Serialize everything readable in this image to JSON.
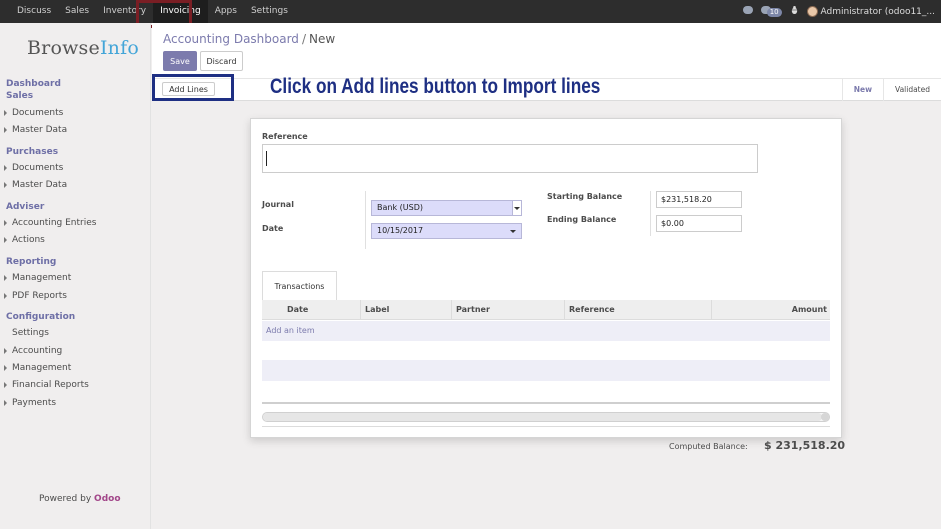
{
  "topbar": {
    "nav": [
      "Discuss",
      "Sales",
      "Inventory",
      "Invoicing",
      "Apps",
      "Settings"
    ],
    "active": "Invoicing",
    "chat_count": "",
    "activity_count": "10",
    "user": "Administrator (odoo11_..."
  },
  "sidebar": {
    "logo_main": "Browse",
    "logo_accent": "Info",
    "dashboard": "Dashboard",
    "sales": {
      "title": "Sales",
      "items": [
        "Documents",
        "Master Data"
      ]
    },
    "purchases": {
      "title": "Purchases",
      "items": [
        "Documents",
        "Master Data"
      ]
    },
    "adviser": {
      "title": "Adviser",
      "items": [
        "Accounting Entries",
        "Actions"
      ]
    },
    "reporting": {
      "title": "Reporting",
      "items": [
        "Management",
        "PDF Reports"
      ]
    },
    "configuration": {
      "title": "Configuration",
      "items": [
        "Settings",
        "Accounting",
        "Management",
        "Financial Reports",
        "Payments"
      ]
    },
    "powered_by": "Powered by",
    "odoo": "Odoo"
  },
  "control": {
    "breadcrumb_parent": "Accounting Dashboard",
    "breadcrumb_sep": "/",
    "breadcrumb_current": "New",
    "save": "Save",
    "discard": "Discard",
    "add_lines": "Add Lines",
    "annotation": "Click on Add lines button to Import lines",
    "status": [
      "New",
      "Validated"
    ],
    "status_current": "New"
  },
  "form": {
    "reference_label": "Reference",
    "reference_value": "",
    "journal_label": "Journal",
    "journal_value": "Bank (USD)",
    "date_label": "Date",
    "date_value": "10/15/2017",
    "starting_balance_label": "Starting Balance",
    "starting_balance_value": "$231,518.20",
    "ending_balance_label": "Ending Balance",
    "ending_balance_value": "$0.00",
    "tab": "Transactions",
    "columns": [
      "Date",
      "Label",
      "Partner",
      "Reference",
      "Amount"
    ],
    "add_item": "Add an item",
    "computed_label": "Computed Balance:",
    "computed_value": "$ 231,518.20"
  },
  "colors": {
    "accent": "#7c7bad",
    "annotation": "#1e2f83",
    "active_highlight": "#7a1e24",
    "topbar": "#2d2d2d"
  }
}
